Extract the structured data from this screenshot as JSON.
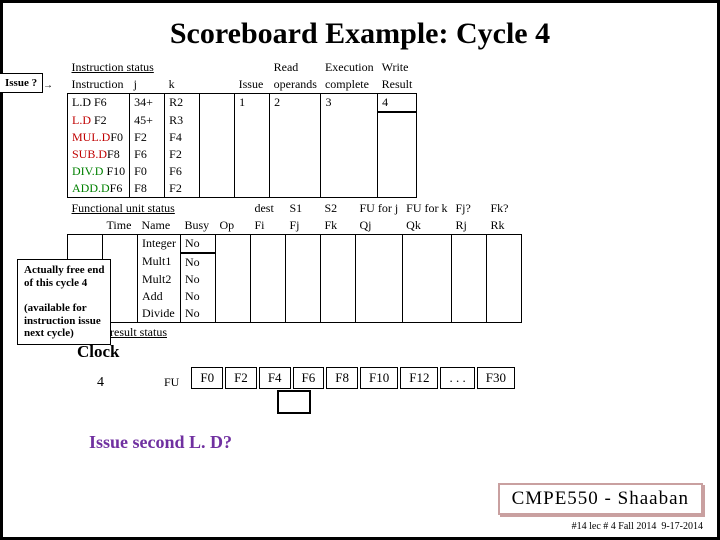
{
  "title": "Scoreboard Example:  Cycle 4",
  "callout1": "Issue ?",
  "callout2": {
    "l1": "Actually free end",
    "l2": "of this cycle 4",
    "l3": "(available for",
    "l4": "instruction issue",
    "l5": "next cycle)"
  },
  "is": {
    "hdr": "Instruction status",
    "read": "Read",
    "exec": "Execution",
    "write": "Write",
    "c": {
      "in": "Instruction",
      "j": "j",
      "k": "k",
      "issue": "Issue",
      "op": "operands",
      "comp": "complete",
      "res": "Result"
    }
  },
  "ins": [
    {
      "op": "L.D",
      "d": "F6",
      "j": "34+",
      "k": "R2",
      "iss": "1",
      "rd": "2",
      "ex": "3",
      "wr": "4"
    },
    {
      "op": "L.D",
      "d": "F2",
      "j": "45+",
      "k": "R3"
    },
    {
      "op": "MUL.D",
      "d": "F0",
      "j": "F2",
      "k": "F4"
    },
    {
      "op": "SUB.D",
      "d": "F8",
      "j": "F6",
      "k": "F2"
    },
    {
      "op": "DIV.D",
      "d": "F10",
      "j": "F0",
      "k": "F6"
    },
    {
      "op": "ADD.D",
      "d": "F6",
      "j": "F8",
      "k": "F2"
    }
  ],
  "fu": {
    "hdr": "Functional unit status",
    "dest": "dest",
    "s1": "S1",
    "s2": "S2",
    "fuj": "FU for j",
    "fuk": "FU for k",
    "fjq": "Fj?",
    "fkq": "Fk?",
    "time": "Time",
    "name": "Name",
    "busy": "Busy",
    "op": "Op",
    "fi": "Fi",
    "fj": "Fj",
    "fk": "Fk",
    "qj": "Qj",
    "qk": "Qk",
    "rj": "Rj",
    "rk": "Rk"
  },
  "units": [
    {
      "n": "Integer",
      "b": "No"
    },
    {
      "n": "Mult1",
      "b": "No"
    },
    {
      "n": "Mult2",
      "b": "No"
    },
    {
      "n": "Add",
      "b": "No"
    },
    {
      "n": "Divide",
      "b": "No"
    }
  ],
  "reg": {
    "hdr": "Register result status",
    "fu": "FU",
    "r": [
      "F0",
      "F2",
      "F4",
      "F6",
      "F8",
      "F10",
      "F12",
      ". . .",
      "F30"
    ]
  },
  "clock": {
    "label": "Clock",
    "val": "4"
  },
  "question": "Issue second L. D?",
  "footer": {
    "course": "CMPE550 - Shaaban",
    "lec": "#14  lec # 4 Fall 2014",
    "date": "9-17-2014"
  }
}
